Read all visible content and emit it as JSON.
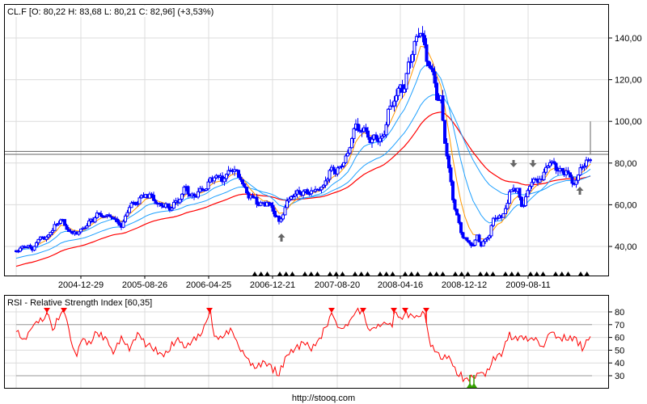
{
  "header": {
    "text": "CL.F [O: 80,22  H: 83,68  L: 80,21  C: 82,96] (+3,53%)"
  },
  "footer": {
    "url": "http://stooq.com"
  },
  "colors": {
    "candle": "#0000ff",
    "ma_short": "#ff9900",
    "ma_mid": "#1ea0ff",
    "ma_long": "#1ea0ff",
    "ma_200": "#ff0000",
    "rsi": "#ff0000",
    "sell_marker": "#ff0000",
    "buy_marker": "#33a000",
    "arrow": "#666666"
  },
  "chart_data": [
    {
      "type": "line",
      "title": "CL.F",
      "subtitle": "O: 80,22 H: 83,68 L: 80,21 C: 82,96 (+3,53%)",
      "x_unit": "week index",
      "x_tick_weeks": [
        16,
        31.8,
        47.6,
        63.4,
        79.4,
        95,
        110.8,
        126.6
      ],
      "x_tick_labels": [
        "2004-12-29",
        "2005-08-26",
        "2006-04-25",
        "2006-12-21",
        "2007-08-20",
        "2008-04-16",
        "2008-12-12",
        "2009-08-11"
      ],
      "y_ticks": [
        40,
        60,
        80,
        100,
        120,
        140
      ],
      "y_tick_labels": [
        "40,00",
        "60,00",
        "80,00",
        "100,00",
        "120,00",
        "140,00"
      ],
      "ylim": [
        25.6,
        158
      ],
      "grid": true,
      "resistance_lines": [
        84.2,
        85.6
      ],
      "last_high_spike": 100,
      "close_points": [
        [
          0,
          38
        ],
        [
          2,
          41
        ],
        [
          4,
          39.5
        ],
        [
          6,
          44
        ],
        [
          8,
          45.5
        ],
        [
          11,
          53
        ],
        [
          12,
          49
        ],
        [
          14,
          45
        ],
        [
          16,
          48
        ],
        [
          18,
          52
        ],
        [
          20,
          55
        ],
        [
          22,
          56
        ],
        [
          24,
          53
        ],
        [
          26,
          49
        ],
        [
          28,
          58
        ],
        [
          30,
          61
        ],
        [
          32,
          67
        ],
        [
          34,
          63
        ],
        [
          36,
          61
        ],
        [
          38,
          58
        ],
        [
          40,
          61
        ],
        [
          42,
          67
        ],
        [
          44,
          63
        ],
        [
          46,
          67
        ],
        [
          48,
          74
        ],
        [
          50,
          72
        ],
        [
          52,
          75
        ],
        [
          54,
          76
        ],
        [
          56,
          69
        ],
        [
          58,
          62
        ],
        [
          60,
          60
        ],
        [
          62,
          62
        ],
        [
          64,
          57
        ],
        [
          65,
          52
        ],
        [
          66,
          58
        ],
        [
          68,
          63
        ],
        [
          70,
          65
        ],
        [
          72,
          65
        ],
        [
          74,
          66
        ],
        [
          76,
          71
        ],
        [
          78,
          77
        ],
        [
          80,
          79
        ],
        [
          82,
          85
        ],
        [
          84,
          96
        ],
        [
          86,
          95
        ],
        [
          88,
          90
        ],
        [
          90,
          92
        ],
        [
          92,
          104
        ],
        [
          94,
          114
        ],
        [
          96,
          119
        ],
        [
          97,
          127
        ],
        [
          98,
          131
        ],
        [
          99,
          137
        ],
        [
          100,
          143
        ],
        [
          101,
          135
        ],
        [
          102,
          127
        ],
        [
          103,
          119
        ],
        [
          104,
          112
        ],
        [
          105,
          110
        ],
        [
          106,
          92
        ],
        [
          107,
          77
        ],
        [
          108,
          65
        ],
        [
          109,
          55
        ],
        [
          110,
          47
        ],
        [
          111,
          44
        ],
        [
          112,
          42
        ],
        [
          113,
          40
        ],
        [
          114,
          44
        ],
        [
          115,
          40
        ],
        [
          116,
          42
        ],
        [
          117,
          46
        ],
        [
          118,
          52
        ],
        [
          120,
          54
        ],
        [
          121,
          60
        ],
        [
          122,
          65
        ],
        [
          123,
          69
        ],
        [
          124,
          67
        ],
        [
          125,
          60
        ],
        [
          126,
          63
        ],
        [
          127,
          69
        ],
        [
          128,
          71
        ],
        [
          130,
          73
        ],
        [
          132,
          79
        ],
        [
          134,
          77
        ],
        [
          136,
          79
        ],
        [
          137,
          73
        ],
        [
          138,
          71
        ],
        [
          139,
          75
        ],
        [
          140,
          81
        ],
        [
          142,
          82.96
        ]
      ],
      "arrows_down_weeks": [
        123,
        127.8
      ],
      "arrows_up_weeks": [
        65.6,
        139.4
      ],
      "signal_triangles_range_weeks": [
        59,
        141.6
      ]
    },
    {
      "type": "line",
      "title": "RSI - Relative Strength Index [60,35]",
      "y_ticks": [
        30,
        40,
        50,
        60,
        70,
        80
      ],
      "y_tick_labels": [
        "30",
        "40",
        "50",
        "60",
        "70",
        "80"
      ],
      "ylim": [
        20.5,
        93
      ],
      "thresholds": [
        30,
        70
      ],
      "rsi_points": [
        [
          0,
          65
        ],
        [
          2,
          58.5
        ],
        [
          4,
          68
        ],
        [
          6,
          74
        ],
        [
          8,
          79
        ],
        [
          9,
          65
        ],
        [
          11,
          79
        ],
        [
          12,
          80
        ],
        [
          14,
          52
        ],
        [
          15,
          46
        ],
        [
          16,
          58.5
        ],
        [
          18,
          55
        ],
        [
          20,
          65
        ],
        [
          22,
          58.5
        ],
        [
          24,
          49
        ],
        [
          26,
          58.5
        ],
        [
          28,
          52
        ],
        [
          30,
          62
        ],
        [
          32,
          55
        ],
        [
          34,
          52
        ],
        [
          36,
          46
        ],
        [
          38,
          52
        ],
        [
          40,
          58.5
        ],
        [
          42,
          52
        ],
        [
          44,
          58.5
        ],
        [
          46,
          65
        ],
        [
          48,
          80
        ],
        [
          49,
          58.5
        ],
        [
          51,
          62
        ],
        [
          53,
          65
        ],
        [
          55,
          55
        ],
        [
          57,
          43
        ],
        [
          59,
          36
        ],
        [
          61,
          39.5
        ],
        [
          63,
          36
        ],
        [
          65,
          32
        ],
        [
          67,
          46
        ],
        [
          69,
          52
        ],
        [
          71,
          55
        ],
        [
          73,
          52
        ],
        [
          75,
          58.5
        ],
        [
          77,
          71
        ],
        [
          78,
          80
        ],
        [
          80,
          65
        ],
        [
          82,
          71
        ],
        [
          84,
          80
        ],
        [
          86,
          80
        ],
        [
          87,
          65
        ],
        [
          89,
          68
        ],
        [
          91,
          71
        ],
        [
          93,
          71
        ],
        [
          93.5,
          80
        ],
        [
          95,
          74
        ],
        [
          96,
          80
        ],
        [
          98,
          75.5
        ],
        [
          100,
          77.5
        ],
        [
          101,
          80
        ],
        [
          102,
          58.5
        ],
        [
          103,
          52
        ],
        [
          105,
          46
        ],
        [
          107,
          43
        ],
        [
          109,
          33
        ],
        [
          111,
          27
        ],
        [
          112.5,
          28
        ],
        [
          114,
          32
        ],
        [
          116,
          32
        ],
        [
          118,
          43
        ],
        [
          120,
          46
        ],
        [
          122,
          62
        ],
        [
          124,
          58.5
        ],
        [
          126,
          60
        ],
        [
          128,
          58.5
        ],
        [
          130,
          52
        ],
        [
          132,
          65
        ],
        [
          134,
          58.5
        ],
        [
          136,
          60
        ],
        [
          138,
          58.5
        ],
        [
          140,
          52
        ],
        [
          142,
          60
        ]
      ],
      "sell_signal_weeks": [
        7.6,
        11.8,
        47.8,
        78,
        85.8,
        93.4,
        96.2,
        101.4
      ],
      "buy_signal_weeks": [
        112.2,
        113.2
      ]
    }
  ]
}
